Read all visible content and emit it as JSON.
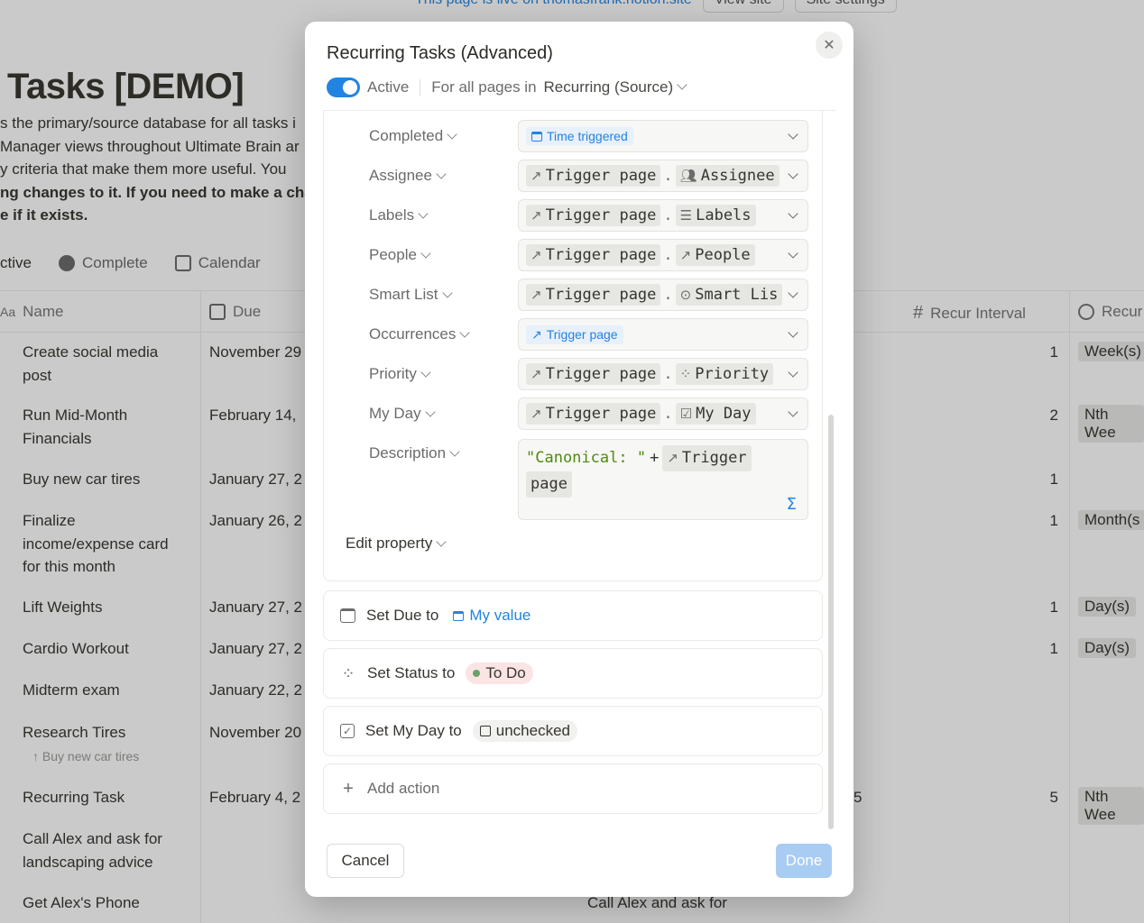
{
  "background": {
    "topbar": {
      "live_text": "This page is live on thomasfrank.notion.site",
      "view_site": "View site",
      "site_settings": "Site settings"
    },
    "page_title": "Tasks [DEMO]",
    "description_lines": [
      "s the primary/source database for all tasks i",
      "Manager views throughout Ultimate Brain ar",
      "y criteria that make them more useful. You",
      "ng changes to it. If you need to make a cha",
      "e if it exists."
    ],
    "views": [
      "ctive",
      "Complete",
      "Calendar"
    ],
    "columns": {
      "name": "Name",
      "due": "Due",
      "recur_interval": "Recur Interval",
      "recur_unit": "Recur"
    },
    "rows": [
      {
        "name": "Create social media post",
        "due": "November 29",
        "interval": "1",
        "unit": "Week(s)"
      },
      {
        "name": "Run Mid-Month Financials",
        "due": "February 14,",
        "interval": "2",
        "unit": "Nth Wee"
      },
      {
        "name": "Buy new car tires",
        "due": "January 27, 2",
        "interval": "1",
        "unit": ""
      },
      {
        "name": "Finalize income/expense card for this month",
        "due": "January 26, 2",
        "interval": "1",
        "unit": "Month(s"
      },
      {
        "name": "Lift Weights",
        "due": "January 27, 2",
        "interval": "1",
        "unit": "Day(s)"
      },
      {
        "name": "Cardio Workout",
        "due": "January 27, 2",
        "interval": "1",
        "unit": "Day(s)"
      },
      {
        "name": "Midterm exam",
        "due": "January 22, 2",
        "interval": "",
        "unit": ""
      },
      {
        "name": "Research Tires",
        "due": "November 20",
        "interval": "",
        "unit": ""
      },
      {
        "name": "Recurring Task",
        "due": "February 4, 2",
        "interval": "5",
        "unit": "Nth Wee"
      },
      {
        "name": "Call Alex and ask for landscaping advice",
        "due": "",
        "interval": "",
        "unit": ""
      },
      {
        "name": "Get Alex's Phone",
        "due": "",
        "interval": "",
        "unit": ""
      }
    ],
    "subtask_ref": "Buy new car tires",
    "middle_value": "5",
    "bottom_ref": "Call Alex and ask for"
  },
  "modal": {
    "title": "Recurring Tasks (Advanced)",
    "active_label": "Active",
    "scope_prefix": "For all pages in",
    "scope_db": "Recurring (Source)",
    "properties": [
      {
        "label": "Completed",
        "kind": "blue",
        "value": "Time triggered"
      },
      {
        "label": "Assignee",
        "kind": "mapped",
        "source": "Trigger page",
        "field": "Assignee",
        "field_icon": "people-icon"
      },
      {
        "label": "Labels",
        "kind": "mapped",
        "source": "Trigger page",
        "field": "Labels",
        "field_icon": "list-icon"
      },
      {
        "label": "People",
        "kind": "mapped",
        "source": "Trigger page",
        "field": "People",
        "field_icon": "arrow-icon"
      },
      {
        "label": "Smart List",
        "kind": "mapped",
        "source": "Trigger page",
        "field": "Smart Lis",
        "field_icon": "status-icon"
      },
      {
        "label": "Occurrences",
        "kind": "blue",
        "value": "Trigger page"
      },
      {
        "label": "Priority",
        "kind": "mapped",
        "source": "Trigger page",
        "field": "Priority",
        "field_icon": "status-icon"
      },
      {
        "label": "My Day",
        "kind": "mapped",
        "source": "Trigger page",
        "field": "My Day",
        "field_icon": "checkbox-icon"
      }
    ],
    "description": {
      "label": "Description",
      "string_part": "\"Canonical: \"",
      "operator": "+",
      "chip_line1": "Trigger",
      "chip_line2": "page",
      "sigma": "Σ"
    },
    "edit_property": "Edit property",
    "actions": {
      "due": {
        "prefix": "Set Due to",
        "value": "My value"
      },
      "status": {
        "prefix": "Set Status to",
        "value": "To Do"
      },
      "myday": {
        "prefix": "Set My Day to",
        "value": "unchecked"
      },
      "add": "Add action"
    },
    "cancel": "Cancel",
    "done": "Done"
  }
}
